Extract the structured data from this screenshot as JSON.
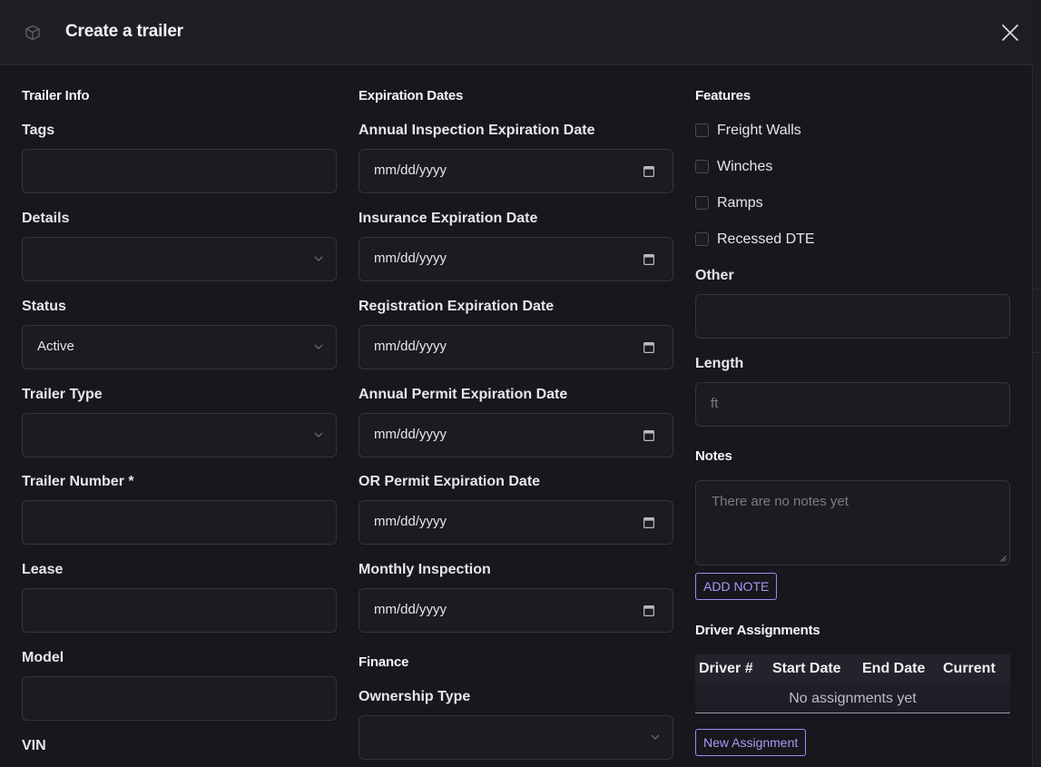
{
  "header": {
    "title": "Create a trailer",
    "cube_icon": "cube-icon",
    "close_icon": "close-icon"
  },
  "trailer_info": {
    "section_title": "Trailer Info",
    "tags_label": "Tags",
    "details_label": "Details",
    "status_label": "Status",
    "status_value": "Active",
    "trailer_type_label": "Trailer Type",
    "trailer_number_label": "Trailer Number *",
    "lease_label": "Lease",
    "model_label": "Model",
    "vin_label": "VIN"
  },
  "expiration_dates": {
    "section_title": "Expiration Dates",
    "date_placeholder": "mm/dd/yyyy",
    "fields": [
      {
        "label": "Annual Inspection Expiration Date",
        "value": "mm/dd/yyyy"
      },
      {
        "label": "Insurance Expiration Date",
        "value": "mm/dd/yyyy"
      },
      {
        "label": "Registration Expiration Date",
        "value": "mm/dd/yyyy"
      },
      {
        "label": "Annual Permit Expiration Date",
        "value": "mm/dd/yyyy"
      },
      {
        "label": "OR Permit Expiration Date",
        "value": "mm/dd/yyyy"
      },
      {
        "label": "Monthly Inspection",
        "value": "mm/dd/yyyy"
      }
    ]
  },
  "finance": {
    "section_title": "Finance",
    "ownership_type_label": "Ownership Type"
  },
  "features": {
    "section_title": "Features",
    "options": [
      {
        "label": "Freight Walls",
        "checked": false
      },
      {
        "label": "Winches",
        "checked": false
      },
      {
        "label": "Ramps",
        "checked": false
      },
      {
        "label": "Recessed DTE",
        "checked": false
      }
    ],
    "other_label": "Other",
    "length_label": "Length",
    "length_placeholder": "ft"
  },
  "notes": {
    "section_title": "Notes",
    "placeholder": "There are no notes yet",
    "add_button": "ADD NOTE"
  },
  "driver_assignments": {
    "section_title": "Driver Assignments",
    "columns": [
      "Driver #",
      "Start Date",
      "End Date",
      "Current"
    ],
    "empty_text": "No assignments yet",
    "new_button": "New Assignment"
  },
  "colors": {
    "accent": "#9b8cf5",
    "background": "#17171d",
    "field_bg": "#1b1b21",
    "border": "#34343c"
  }
}
